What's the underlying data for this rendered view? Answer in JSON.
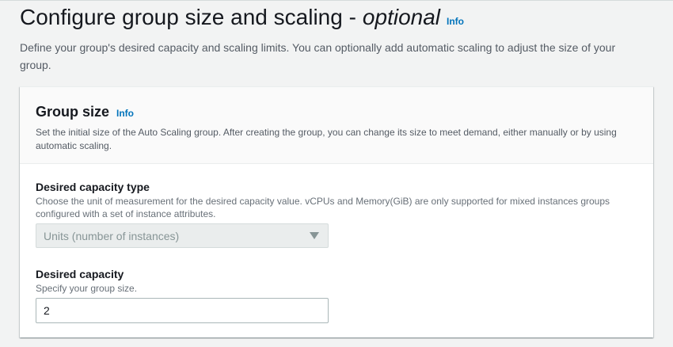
{
  "header": {
    "title": "Configure group size and scaling -",
    "title_optional": "optional",
    "info_label": "Info",
    "description": "Define your group's desired capacity and scaling limits. You can optionally add automatic scaling to adjust the size of your group."
  },
  "group_size": {
    "title": "Group size",
    "info_label": "Info",
    "description": "Set the initial size of the Auto Scaling group. After creating the group, you can change its size to meet demand, either manually or by using automatic scaling."
  },
  "desired_capacity_type": {
    "label": "Desired capacity type",
    "description": "Choose the unit of measurement for the desired capacity value. vCPUs and Memory(GiB) are only supported for mixed instances groups configured with a set of instance attributes.",
    "selected": "Units (number of instances)",
    "arrow_icon": "caret-down-icon"
  },
  "desired_capacity": {
    "label": "Desired capacity",
    "description": "Specify your group size.",
    "value": "2"
  },
  "colors": {
    "link": "#0073bb",
    "background": "#f2f3f3",
    "panel": "#ffffff",
    "disabled_fill": "#eaeded"
  }
}
